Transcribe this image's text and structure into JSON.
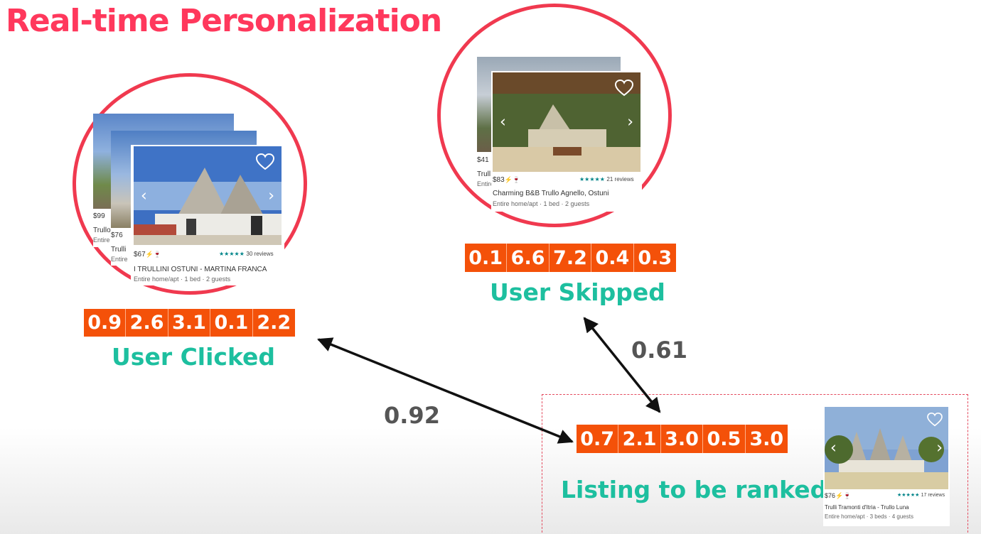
{
  "title": "Real-time Personalization",
  "clicked": {
    "vector": [
      "0.9",
      "2.6",
      "3.1",
      "0.1",
      "2.2"
    ],
    "label": "User Clicked",
    "cards": [
      {
        "price": "$99",
        "name": "Trullo",
        "detail": "Entire"
      },
      {
        "price": "$76",
        "name": "Trulli",
        "detail": "Entire"
      },
      {
        "price": "$67",
        "name": "I TRULLINI OSTUNI - MARTINA FRANCA",
        "detail": "Entire home/apt · 1 bed · 2 guests",
        "reviews": "30 reviews"
      }
    ]
  },
  "skipped": {
    "vector": [
      "0.1",
      "6.6",
      "7.2",
      "0.4",
      "0.3"
    ],
    "label": "User Skipped",
    "cards": [
      {
        "price": "$41",
        "name": "Trull",
        "detail": "Entire"
      },
      {
        "price": "$83",
        "name": "Charming B&B Trullo Agnello, Ostuni",
        "detail": "Entire home/apt · 1 bed · 2 guests",
        "reviews": "21 reviews"
      }
    ]
  },
  "target": {
    "vector": [
      "0.7",
      "2.1",
      "3.0",
      "0.5",
      "3.0"
    ],
    "label": "Listing to be ranked",
    "card": {
      "price": "$76",
      "name": "Trulli Tramonti d'Itria - Trullo Luna",
      "detail": "Entire home/apt · 3 beds · 4 guests",
      "reviews": "17 reviews"
    }
  },
  "similarity": {
    "clicked_to_target": "0.92",
    "skipped_to_target": "0.61"
  },
  "colors": {
    "title": "#ff385c",
    "circle": "#f0394f",
    "vector": "#f45109",
    "label": "#1dbf9f",
    "similarity": "#555555"
  },
  "icons": [
    "heart-icon",
    "chevron-left-icon",
    "chevron-right-icon",
    "star-icon",
    "bolt-icon",
    "double-arrow-icon"
  ]
}
